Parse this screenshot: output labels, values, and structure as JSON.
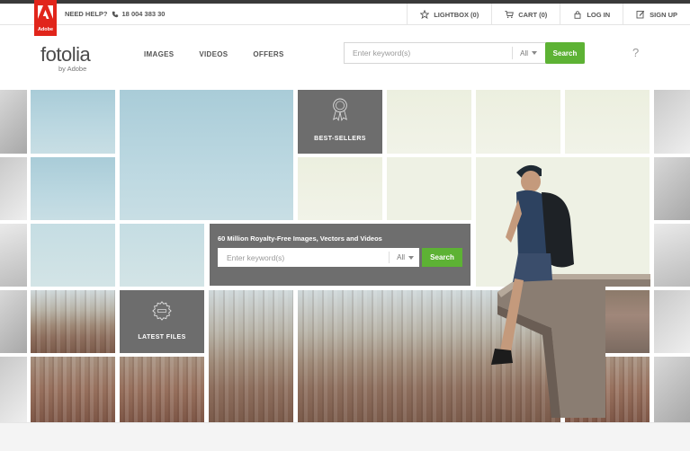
{
  "topbar": {
    "adobe_word": "Adobe",
    "help_label": "NEED HELP?",
    "phone": "18 004 383 30",
    "links": [
      {
        "label": "LIGHTBOX (0)",
        "icon": "star-icon"
      },
      {
        "label": "CART (0)",
        "icon": "cart-icon"
      },
      {
        "label": "LOG IN",
        "icon": "lock-icon"
      },
      {
        "label": "SIGN UP",
        "icon": "pencil-icon"
      }
    ]
  },
  "header": {
    "logo_main": "fotolia",
    "logo_sub": "by Adobe",
    "nav": [
      "IMAGES",
      "VIDEOS",
      "OFFERS"
    ],
    "search": {
      "placeholder": "Enter keyword(s)",
      "filter": "All",
      "button": "Search",
      "help": "?"
    }
  },
  "mosaic": {
    "bestsellers_label": "BEST-SELLERS",
    "latest_label": "LATEST FILES",
    "promo": {
      "title": "60 Million Royalty-Free Images, Vectors and Videos",
      "placeholder": "Enter keyword(s)",
      "filter": "All",
      "button": "Search"
    }
  },
  "colors": {
    "accent_green": "#5db234",
    "adobe_red": "#e1251b",
    "tile_gray": "#6d6d6d"
  }
}
